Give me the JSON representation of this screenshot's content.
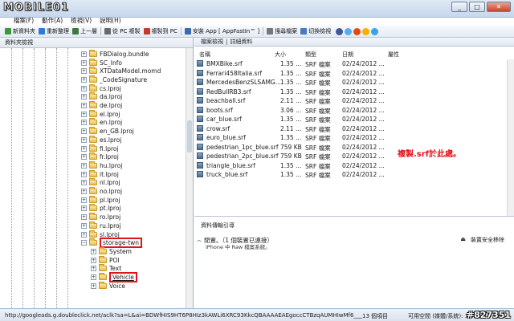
{
  "app": {
    "logo": "MOBILE01",
    "watermark": "#827351"
  },
  "window_controls": [
    "_",
    "□",
    "✕"
  ],
  "menu": [
    "檔案(F)",
    "動作(A)",
    "檢視(V)",
    "說明(H)"
  ],
  "toolbar": {
    "buttons": [
      {
        "label": "新資料夾",
        "icon": "new-folder-icon",
        "color": "#3a9a3a"
      },
      {
        "label": "重新整理",
        "icon": "refresh-icon",
        "color": "#2c7bd6"
      },
      {
        "label": "上一層",
        "icon": "up-arrow-icon",
        "color": "#3c7a3c"
      },
      {
        "label": "從 PC 複製",
        "icon": "copy-from-pc-icon",
        "color": "#6a6a6a"
      },
      {
        "label": "複製到 PC",
        "icon": "copy-to-pc-icon",
        "color": "#c23a2a"
      },
      {
        "label": "安裝 App [ AppFastIn™ ]",
        "icon": "install-app-icon",
        "color": "#3a6ab0"
      },
      {
        "label": "搜尋檔案",
        "icon": "search-icon",
        "color": "#777777"
      },
      {
        "label": "切換檢視",
        "icon": "switch-view-icon",
        "color": "#4a7ac0"
      }
    ],
    "share_colors": [
      "#3b5998",
      "#55acee",
      "#e04a1a",
      "#f2b200",
      "#3aa3e3"
    ]
  },
  "left_pane": {
    "header": "資料夾檢視",
    "tree": [
      {
        "label": "FBDialog.bundle",
        "level": 0,
        "exp": "+"
      },
      {
        "label": "SC_Info",
        "level": 0,
        "exp": "+"
      },
      {
        "label": "XTDataModel.momd",
        "level": 0,
        "exp": "+"
      },
      {
        "label": "_CodeSignature",
        "level": 0,
        "exp": "+"
      },
      {
        "label": "cs.lproj",
        "level": 0,
        "exp": "+"
      },
      {
        "label": "da.lproj",
        "level": 0,
        "exp": "+"
      },
      {
        "label": "de.lproj",
        "level": 0,
        "exp": "+"
      },
      {
        "label": "el.lproj",
        "level": 0,
        "exp": "+"
      },
      {
        "label": "en.lproj",
        "level": 0,
        "exp": "+"
      },
      {
        "label": "en_GB.lproj",
        "level": 0,
        "exp": "+"
      },
      {
        "label": "es.lproj",
        "level": 0,
        "exp": "+"
      },
      {
        "label": "fi.lproj",
        "level": 0,
        "exp": "+"
      },
      {
        "label": "fr.lproj",
        "level": 0,
        "exp": "+"
      },
      {
        "label": "hu.lproj",
        "level": 0,
        "exp": "+"
      },
      {
        "label": "it.lproj",
        "level": 0,
        "exp": "+"
      },
      {
        "label": "nl.lproj",
        "level": 0,
        "exp": "+"
      },
      {
        "label": "no.lproj",
        "level": 0,
        "exp": "+"
      },
      {
        "label": "pl.lproj",
        "level": 0,
        "exp": "+"
      },
      {
        "label": "pt.lproj",
        "level": 0,
        "exp": "+"
      },
      {
        "label": "ro.lproj",
        "level": 0,
        "exp": "+"
      },
      {
        "label": "ru.lproj",
        "level": 0,
        "exp": "+"
      },
      {
        "label": "sl.lproj",
        "level": 0,
        "exp": "+"
      },
      {
        "label": "storage-twn",
        "level": 0,
        "exp": "−",
        "highlight": true
      },
      {
        "label": "System",
        "level": 1,
        "exp": "+"
      },
      {
        "label": "POI",
        "level": 1,
        "exp": "+"
      },
      {
        "label": "Text",
        "level": 1,
        "exp": "+"
      },
      {
        "label": "Vehicle",
        "level": 1,
        "exp": "+",
        "highlight": true
      },
      {
        "label": "Voice",
        "level": 1,
        "exp": "+"
      }
    ]
  },
  "right_pane": {
    "tabs": [
      "檔案檢視",
      "|",
      "詳細資料"
    ],
    "columns": [
      "名稱",
      "大小",
      "類型",
      "日期",
      "屬性"
    ],
    "files": [
      {
        "name": "BMXBike.srf",
        "size": "1.35 ...",
        "type": "SRF 檔案",
        "date": "02/24/2012 ..."
      },
      {
        "name": "Ferrari458Italia.srf",
        "size": "1.35 ...",
        "type": "SRF 檔案",
        "date": "02/24/2012 ..."
      },
      {
        "name": "MercedesBenzSLSAMG...",
        "size": "1.35 ...",
        "type": "SRF 檔案",
        "date": "02/24/2012 ..."
      },
      {
        "name": "RedBullRB3.srf",
        "size": "1.35 ...",
        "type": "SRF 檔案",
        "date": "02/24/2012 ..."
      },
      {
        "name": "beachball.srf",
        "size": "2.11 ...",
        "type": "SRF 檔案",
        "date": "02/24/2012 ..."
      },
      {
        "name": "boots.srf",
        "size": "3.06 ...",
        "type": "SRF 檔案",
        "date": "02/24/2012 ..."
      },
      {
        "name": "car_blue.srf",
        "size": "1.35 ...",
        "type": "SRF 檔案",
        "date": "02/24/2012 ..."
      },
      {
        "name": "crow.srf",
        "size": "2.11 ...",
        "type": "SRF 檔案",
        "date": "02/24/2012 ..."
      },
      {
        "name": "euro_blue.srf",
        "size": "1.35 ...",
        "type": "SRF 檔案",
        "date": "02/24/2012 ..."
      },
      {
        "name": "pedestrian_1pc_blue.srf",
        "size": "759 KB",
        "type": "SRF 檔案",
        "date": "02/24/2012 ..."
      },
      {
        "name": "pedestrian_2pc_blue.srf",
        "size": "759 KB",
        "type": "SRF 檔案",
        "date": "02/24/2012 ..."
      },
      {
        "name": "triangle_blue.srf",
        "size": "1.35 ...",
        "type": "SRF 檔案",
        "date": "02/24/2012 ..."
      },
      {
        "name": "truck_blue.srf",
        "size": "1.35 ...",
        "type": "SRF 檔案",
        "date": "02/24/2012 ..."
      }
    ],
    "annotation": "複製.srf於此處。"
  },
  "guide": {
    "title": "資料傳輸引導",
    "line1": "閒置。（1 個裝置已連接）",
    "line2": "iPhone 中 Raw 檔案系統。",
    "eject": "裝置安全移除"
  },
  "status": {
    "url": "http://googleads.g.doubleclick.net/aclk?sa=L&ai=BDWfHIS9HT6P8HIz3kAWLi6XRC93KkcQBAAAAEAEgoccCTBzqAUMHIwMf6___",
    "count": "13 個項目",
    "space": "可用空間 (媒體/系統): 1.27"
  }
}
